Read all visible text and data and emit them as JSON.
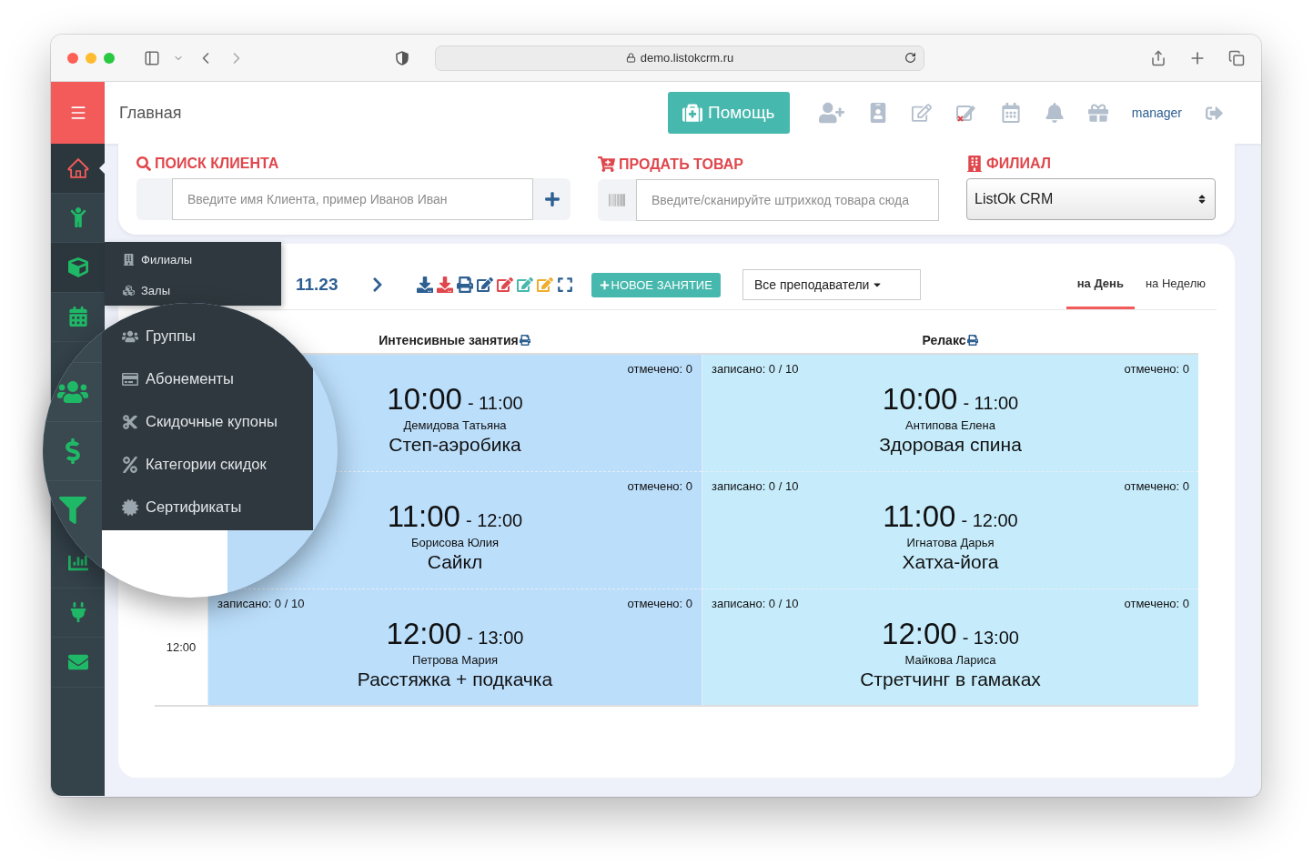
{
  "browser": {
    "url": "demo.listokcrm.ru"
  },
  "header": {
    "title": "Главная",
    "help_button": "Помощь",
    "user": "manager"
  },
  "sidebar": {
    "items": [
      {
        "selected": true,
        "expanded": false
      },
      {
        "selected": false,
        "expanded": false
      },
      {
        "selected": false,
        "expanded": true
      },
      {
        "selected": false,
        "expanded": false
      },
      {
        "selected": false,
        "expanded": false
      },
      {
        "selected": false,
        "expanded": false
      },
      {
        "selected": false,
        "expanded": false
      }
    ]
  },
  "submenu": {
    "items": [
      "Филиалы",
      "Залы"
    ]
  },
  "magnifier": {
    "menu_items": [
      "Группы",
      "Абонементы",
      "Скидочные купоны",
      "Категории скидок",
      "Сертификаты"
    ]
  },
  "search_client": {
    "label": "ПОИСК КЛИЕНТА",
    "placeholder": "Введите имя Клиента, пример Иванов Иван"
  },
  "sell_product": {
    "label": "ПРОДАТЬ ТОВАР",
    "placeholder": "Введите/сканируйте штрихкод товара сюда"
  },
  "branch": {
    "label": "ФИЛИАЛ",
    "value": "ListOk CRM"
  },
  "toolbar": {
    "date": "11.23",
    "new_button": "НОВОЕ ЗАНЯТИЕ",
    "teacher_filter": "Все преподаватели",
    "tabs": [
      {
        "label": "на День",
        "selected": true
      },
      {
        "label": "на Неделю",
        "selected": false
      }
    ]
  },
  "schedule": {
    "columns": [
      {
        "name": "Интенсивные занятия",
        "color": "#bbdefb"
      },
      {
        "name": "Релакс",
        "color": "#c6ecfc"
      }
    ],
    "rows": [
      {
        "cells": [
          {
            "marked": "отмечено: 0",
            "start": "10:00",
            "end": "- 11:00",
            "trainer": "Демидова Татьяна",
            "title": "Степ-аэробика"
          },
          {
            "enrolled": "записано: 0 / 10",
            "marked": "отмечено: 0",
            "start": "10:00",
            "end": "- 11:00",
            "trainer": "Антипова Елена",
            "title": "Здоровая спина"
          }
        ]
      },
      {
        "cells": [
          {
            "marked": "отмечено: 0",
            "start": "11:00",
            "end": "- 12:00",
            "trainer": "Борисова Юлия",
            "title": "Сайкл"
          },
          {
            "enrolled": "записано: 0 / 10",
            "marked": "отмечено: 0",
            "start": "11:00",
            "end": "- 12:00",
            "trainer": "Игнатова Дарья",
            "title": "Хатха-йога"
          }
        ]
      },
      {
        "time": "12:00",
        "cells": [
          {
            "enrolled": "записано: 0 / 10",
            "marked": "отмечено: 0",
            "start": "12:00",
            "end": "- 13:00",
            "trainer": "Петрова Мария",
            "title": "Расстяжка + подкачка"
          },
          {
            "enrolled": "записано: 0 / 10",
            "marked": "отмечено: 0",
            "start": "12:00",
            "end": "- 13:00",
            "trainer": "Майкова Лариса",
            "title": "Стретчинг в гамаках"
          }
        ]
      }
    ]
  }
}
